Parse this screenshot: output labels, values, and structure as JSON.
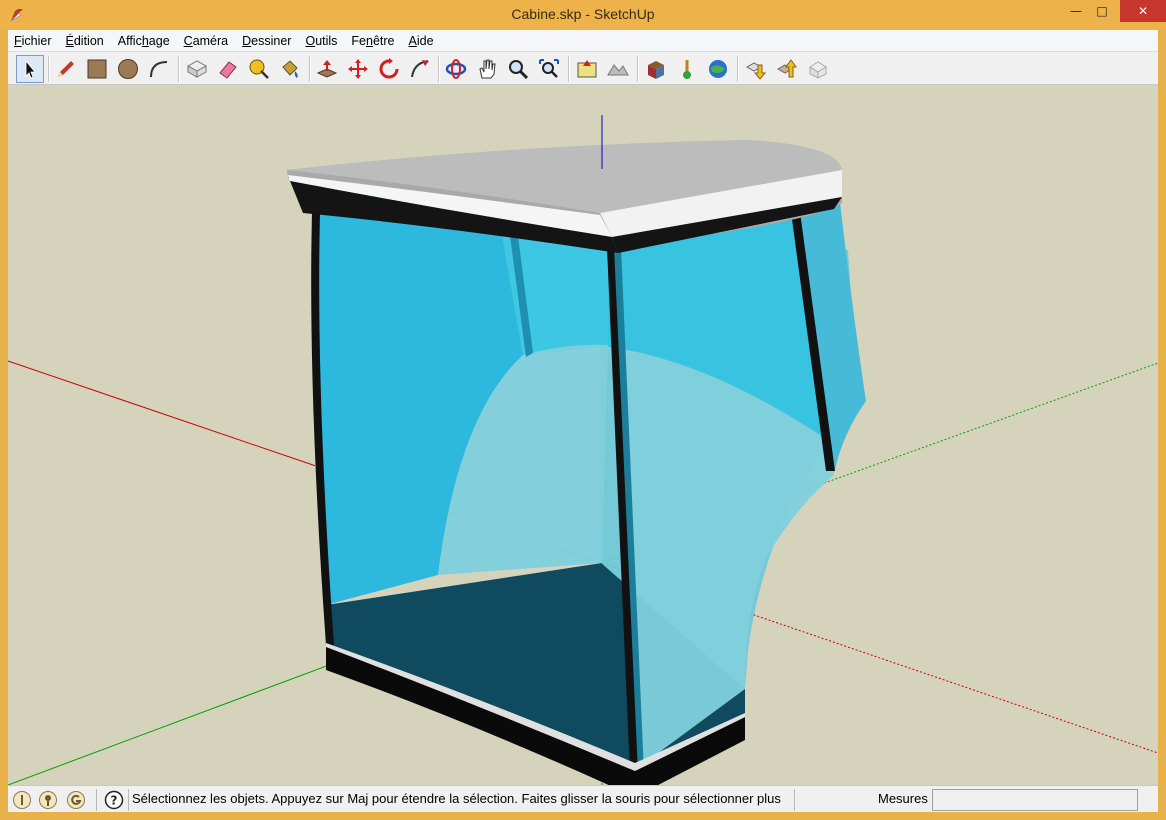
{
  "window": {
    "title": "Cabine.skp - SketchUp",
    "controls": {
      "minimize": "—",
      "maximize": "□",
      "close": "✕"
    }
  },
  "menubar": [
    {
      "pre": "",
      "key": "F",
      "post": "ichier"
    },
    {
      "pre": "",
      "key": "É",
      "post": "dition"
    },
    {
      "pre": "Affic",
      "key": "h",
      "post": "age"
    },
    {
      "pre": "",
      "key": "C",
      "post": "améra"
    },
    {
      "pre": "",
      "key": "D",
      "post": "essiner"
    },
    {
      "pre": "",
      "key": "O",
      "post": "utils"
    },
    {
      "pre": "Fe",
      "key": "n",
      "post": "être"
    },
    {
      "pre": "",
      "key": "A",
      "post": "ide"
    }
  ],
  "toolbar": {
    "tools": [
      "select-tool",
      "pencil-tool",
      "rectangle-tool",
      "circle-tool",
      "arc-tool",
      "make-component-tool",
      "eraser-tool",
      "tape-measure-tool",
      "paint-bucket-tool",
      "push-pull-tool",
      "move-tool",
      "rotate-tool",
      "follow-me-tool",
      "orbit-tool",
      "pan-tool",
      "zoom-tool",
      "zoom-extents-tool",
      "add-location-tool",
      "toggle-terrain-tool",
      "photo-textures-tool",
      "preview-google-earth-tool",
      "get-models-tool",
      "share-model-tool",
      "share-component-tool",
      "extension-warehouse-tool"
    ]
  },
  "colors": {
    "titlebar": "#eeb24b",
    "viewport_bg": "#d6d3bd",
    "glass": "#3bbfdc",
    "glass_dark": "#1d8cad",
    "roof": "#bdbdbd",
    "axis_red": "#cc0000",
    "axis_green": "#00a000",
    "axis_blue": "#0000cc"
  },
  "statusbar": {
    "icons": [
      "geo-location-icon",
      "credits-icon",
      "google-sign-in-icon",
      "help-icon"
    ],
    "message": "Sélectionnez les objets. Appuyez sur Maj pour étendre la sélection. Faites glisser la souris pour sélectionner plus",
    "measures_label": "Mesures",
    "measures_value": ""
  }
}
